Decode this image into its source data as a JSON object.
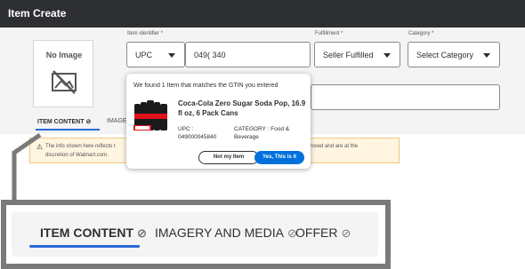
{
  "header": {
    "title": "Item Create"
  },
  "image_placeholder": {
    "label": "No Image",
    "icon": "no-image-icon"
  },
  "item_identifier": {
    "label": "Item identifier *",
    "type_value": "UPC",
    "id_value": "049(              340"
  },
  "fulfillment": {
    "label": "Fulfillment *",
    "value": "Seller Fulfilled"
  },
  "category": {
    "label": "Category *",
    "value": "Select Category"
  },
  "tabs_small": {
    "item_content": "ITEM CONTENT ⊘",
    "imagery": "IMAGE"
  },
  "notice": {
    "line1": "The info shown here reflects t",
    "line2": "discretion of Walmart.com.",
    "right": "be approved and are at the"
  },
  "popup": {
    "message": "We found 1 Item that matches the GTIN you entered",
    "product_name": "Coca-Cola Zero Sugar Soda Pop, 16.9 fl oz, 6 Pack Cans",
    "upc_label": "UPC :",
    "upc_value": "049000045840",
    "category_label": "CATEGORY : Food &",
    "category_value": "Beverage",
    "not_my_item": "Not my Item",
    "yes_this_is_it": "Yes, This is it"
  },
  "zoom_tabs": {
    "item_content": "ITEM CONTENT",
    "imagery_media": "IMAGERY AND MEDIA",
    "offer": "OFFER"
  },
  "colors": {
    "header_bg": "#2e2f32",
    "accent": "#2a6ad9",
    "primary_button": "#0071dc",
    "notice_bg": "#fff5e0",
    "frame": "#7a7a7a"
  }
}
